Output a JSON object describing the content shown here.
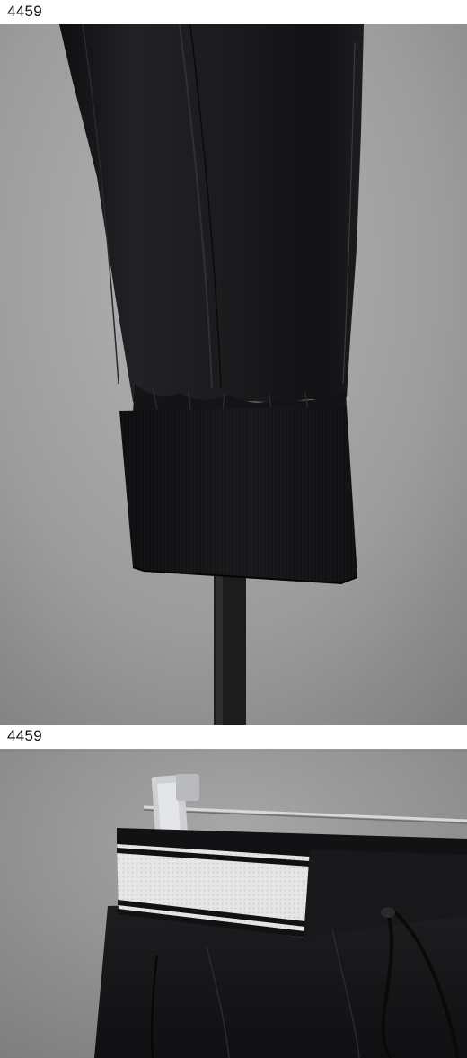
{
  "panels": [
    {
      "label": "4459",
      "subject": "pant-leg-cuff-closeup"
    },
    {
      "label": "4459",
      "subject": "waistband-on-hanger-closeup"
    }
  ],
  "colors": {
    "background_gray": "#9a9a9a",
    "fabric_black": "#1a1a1c",
    "rib_black": "#131315",
    "waistband_white": "#e9e9e9",
    "stand_pole": "#1c1c1c"
  }
}
